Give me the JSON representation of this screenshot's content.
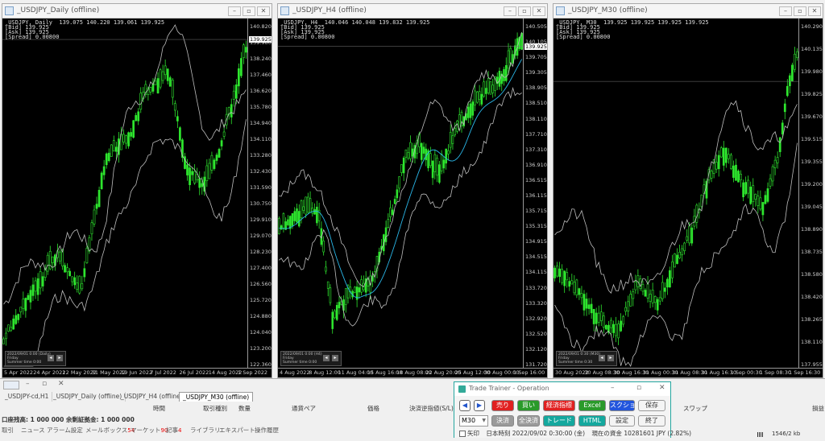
{
  "windows": [
    {
      "title": "_USDJPY_Daily (offline)",
      "info": [
        "_USDJPY, Daily  139.075 140.220 139.061 139.925",
        "[Bid] 139.925",
        "[Ask] 139.925",
        "[Spread] 0.00800"
      ],
      "price_tag": "139.925",
      "price_labels": [
        "140.820",
        "139.980",
        "138.240",
        "137.460",
        "136.620",
        "135.780",
        "134.940",
        "134.110",
        "133.280",
        "132.430",
        "131.590",
        "130.750",
        "129.910",
        "129.070",
        "128.230",
        "127.400",
        "126.560",
        "125.720",
        "124.880",
        "124.040",
        "123.200",
        "122.360"
      ],
      "time_labels": [
        "5 Apr 2022",
        "24 Apr 2022",
        "12 May 2022",
        "31 May 2022",
        "19 Jun 2022",
        "7 Jul 2022",
        "26 Jul 2022",
        "14 Aug 2022",
        "1 Sep 2022"
      ],
      "mini": [
        "2022/09/01 0:00 (Daily)",
        "Friday",
        "Summer time  0:00"
      ]
    },
    {
      "title": "_USDJPY_H4 (offline)",
      "info": [
        "_USDJPY, H4  140.046 140.048 139.832 139.925",
        "[Bid] 139.925",
        "[Ask] 139.925",
        "[Spread] 0.00800"
      ],
      "price_tag": "139.925",
      "price_labels": [
        "140.505",
        "140.105",
        "139.705",
        "139.305",
        "138.905",
        "138.510",
        "138.110",
        "137.710",
        "137.310",
        "136.910",
        "136.515",
        "136.115",
        "135.715",
        "135.315",
        "134.915",
        "134.515",
        "134.115",
        "133.720",
        "133.320",
        "132.920",
        "132.520",
        "132.120",
        "131.720"
      ],
      "time_labels": [
        "4 Aug 2022",
        "8 Aug 12:00",
        "11 Aug 04:00",
        "15 Aug 16:00",
        "18 Aug 08:00",
        "22 Aug 20:00",
        "25 Aug 12:00",
        "30 Aug 00:00",
        "1 Sep 16:00"
      ],
      "mini": [
        "2022/09/01 0:00 (H4)",
        "Friday",
        "Summer time  0:00"
      ]
    },
    {
      "title": "_USDJPY_M30 (offline)",
      "info": [
        "_USDJPY, M30  139.925 139.925 139.925 139.925",
        "[Bid] 139.925",
        "[Ask] 139.925",
        "[Spread] 0.00800"
      ],
      "price_tag": "",
      "price_labels": [
        "140.290",
        "140.135",
        "139.980",
        "139.825",
        "139.670",
        "139.515",
        "139.355",
        "139.200",
        "139.045",
        "138.890",
        "138.735",
        "138.580",
        "138.420",
        "138.265",
        "138.110",
        "137.955"
      ],
      "time_labels": [
        "30 Aug 2022",
        "30 Aug 08:30",
        "30 Aug 16:30",
        "31 Aug 00:30",
        "31 Aug 08:30",
        "31 Aug 16:30",
        "1 Sep 00:30",
        "1 Sep 08:30",
        "1 Sep 16:30"
      ],
      "mini": [
        "2022/09/01 0:30 (M30)",
        "Friday",
        "Summer time  0:30"
      ]
    }
  ],
  "bottom": {
    "tabs": [
      "_USDJPY-cd,H1",
      "_USDJPY_Daily (offline)",
      "_USDJPY_H4 (offline)",
      "_USDJPY_M30 (offline)"
    ],
    "columns": [
      "時間",
      "取引種別",
      "数量",
      "通貨ペア",
      "価格",
      "決済逆指値(S/L)",
      "スワップ",
      "損益"
    ],
    "balance": "口座残高: 1 000 000   余剰証拠金: 1 000 000",
    "terminal_tabs": [
      "取引",
      "ニュース",
      "アラーム設定",
      "メールボックス",
      "マーケット",
      "記事",
      "ライブラリ",
      "エキスパート",
      "操作履歴"
    ],
    "mailbox_count": "54",
    "market_count": "90",
    "articles_count": "4",
    "traffic": "1546/2 kb"
  },
  "trainer": {
    "title": "Trade Trainer - Operation",
    "buttons_row1": [
      "売り",
      "買い",
      "経済指標",
      "Excel",
      "スクショ",
      "保存"
    ],
    "buttons_row2": [
      "決済",
      "全決済",
      "トレード",
      "HTML",
      "設定",
      "終了"
    ],
    "timeframe": "M30",
    "arrow_checkbox": "矢印",
    "japan_time": "日本時刻 2022/09/02 0:30:00 (金)",
    "capital": "現在の資金 10281601 JPY (2.82%)"
  }
}
